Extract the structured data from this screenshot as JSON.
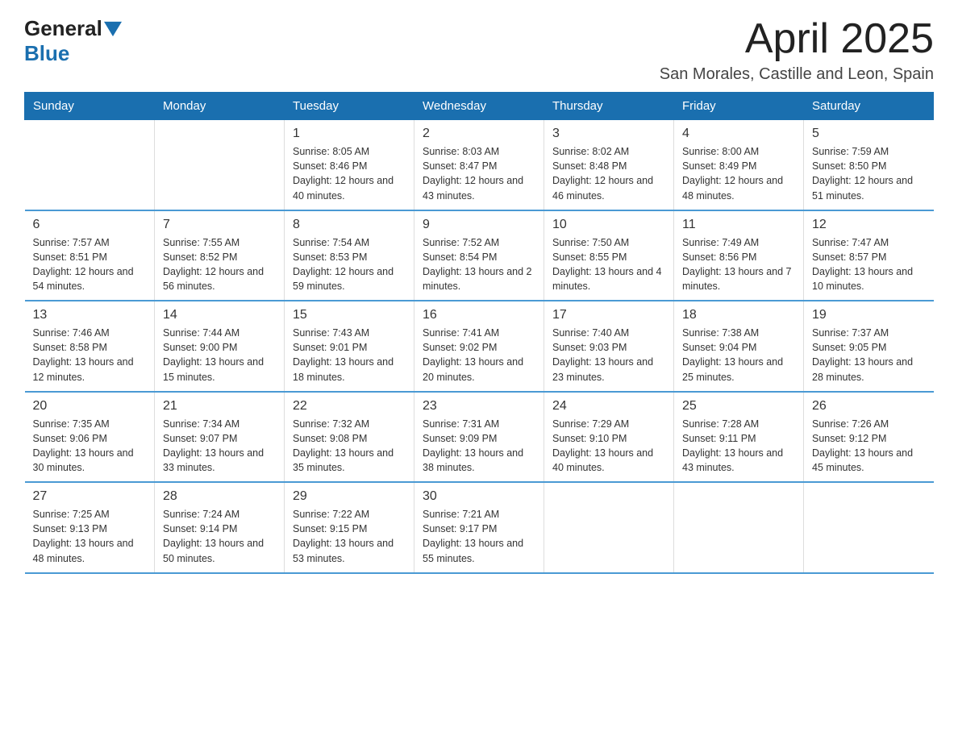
{
  "logo": {
    "text_general": "General",
    "text_blue": "Blue"
  },
  "header": {
    "month": "April 2025",
    "location": "San Morales, Castille and Leon, Spain"
  },
  "weekdays": [
    "Sunday",
    "Monday",
    "Tuesday",
    "Wednesday",
    "Thursday",
    "Friday",
    "Saturday"
  ],
  "weeks": [
    [
      {
        "day": "",
        "sunrise": "",
        "sunset": "",
        "daylight": ""
      },
      {
        "day": "",
        "sunrise": "",
        "sunset": "",
        "daylight": ""
      },
      {
        "day": "1",
        "sunrise": "Sunrise: 8:05 AM",
        "sunset": "Sunset: 8:46 PM",
        "daylight": "Daylight: 12 hours and 40 minutes."
      },
      {
        "day": "2",
        "sunrise": "Sunrise: 8:03 AM",
        "sunset": "Sunset: 8:47 PM",
        "daylight": "Daylight: 12 hours and 43 minutes."
      },
      {
        "day": "3",
        "sunrise": "Sunrise: 8:02 AM",
        "sunset": "Sunset: 8:48 PM",
        "daylight": "Daylight: 12 hours and 46 minutes."
      },
      {
        "day": "4",
        "sunrise": "Sunrise: 8:00 AM",
        "sunset": "Sunset: 8:49 PM",
        "daylight": "Daylight: 12 hours and 48 minutes."
      },
      {
        "day": "5",
        "sunrise": "Sunrise: 7:59 AM",
        "sunset": "Sunset: 8:50 PM",
        "daylight": "Daylight: 12 hours and 51 minutes."
      }
    ],
    [
      {
        "day": "6",
        "sunrise": "Sunrise: 7:57 AM",
        "sunset": "Sunset: 8:51 PM",
        "daylight": "Daylight: 12 hours and 54 minutes."
      },
      {
        "day": "7",
        "sunrise": "Sunrise: 7:55 AM",
        "sunset": "Sunset: 8:52 PM",
        "daylight": "Daylight: 12 hours and 56 minutes."
      },
      {
        "day": "8",
        "sunrise": "Sunrise: 7:54 AM",
        "sunset": "Sunset: 8:53 PM",
        "daylight": "Daylight: 12 hours and 59 minutes."
      },
      {
        "day": "9",
        "sunrise": "Sunrise: 7:52 AM",
        "sunset": "Sunset: 8:54 PM",
        "daylight": "Daylight: 13 hours and 2 minutes."
      },
      {
        "day": "10",
        "sunrise": "Sunrise: 7:50 AM",
        "sunset": "Sunset: 8:55 PM",
        "daylight": "Daylight: 13 hours and 4 minutes."
      },
      {
        "day": "11",
        "sunrise": "Sunrise: 7:49 AM",
        "sunset": "Sunset: 8:56 PM",
        "daylight": "Daylight: 13 hours and 7 minutes."
      },
      {
        "day": "12",
        "sunrise": "Sunrise: 7:47 AM",
        "sunset": "Sunset: 8:57 PM",
        "daylight": "Daylight: 13 hours and 10 minutes."
      }
    ],
    [
      {
        "day": "13",
        "sunrise": "Sunrise: 7:46 AM",
        "sunset": "Sunset: 8:58 PM",
        "daylight": "Daylight: 13 hours and 12 minutes."
      },
      {
        "day": "14",
        "sunrise": "Sunrise: 7:44 AM",
        "sunset": "Sunset: 9:00 PM",
        "daylight": "Daylight: 13 hours and 15 minutes."
      },
      {
        "day": "15",
        "sunrise": "Sunrise: 7:43 AM",
        "sunset": "Sunset: 9:01 PM",
        "daylight": "Daylight: 13 hours and 18 minutes."
      },
      {
        "day": "16",
        "sunrise": "Sunrise: 7:41 AM",
        "sunset": "Sunset: 9:02 PM",
        "daylight": "Daylight: 13 hours and 20 minutes."
      },
      {
        "day": "17",
        "sunrise": "Sunrise: 7:40 AM",
        "sunset": "Sunset: 9:03 PM",
        "daylight": "Daylight: 13 hours and 23 minutes."
      },
      {
        "day": "18",
        "sunrise": "Sunrise: 7:38 AM",
        "sunset": "Sunset: 9:04 PM",
        "daylight": "Daylight: 13 hours and 25 minutes."
      },
      {
        "day": "19",
        "sunrise": "Sunrise: 7:37 AM",
        "sunset": "Sunset: 9:05 PM",
        "daylight": "Daylight: 13 hours and 28 minutes."
      }
    ],
    [
      {
        "day": "20",
        "sunrise": "Sunrise: 7:35 AM",
        "sunset": "Sunset: 9:06 PM",
        "daylight": "Daylight: 13 hours and 30 minutes."
      },
      {
        "day": "21",
        "sunrise": "Sunrise: 7:34 AM",
        "sunset": "Sunset: 9:07 PM",
        "daylight": "Daylight: 13 hours and 33 minutes."
      },
      {
        "day": "22",
        "sunrise": "Sunrise: 7:32 AM",
        "sunset": "Sunset: 9:08 PM",
        "daylight": "Daylight: 13 hours and 35 minutes."
      },
      {
        "day": "23",
        "sunrise": "Sunrise: 7:31 AM",
        "sunset": "Sunset: 9:09 PM",
        "daylight": "Daylight: 13 hours and 38 minutes."
      },
      {
        "day": "24",
        "sunrise": "Sunrise: 7:29 AM",
        "sunset": "Sunset: 9:10 PM",
        "daylight": "Daylight: 13 hours and 40 minutes."
      },
      {
        "day": "25",
        "sunrise": "Sunrise: 7:28 AM",
        "sunset": "Sunset: 9:11 PM",
        "daylight": "Daylight: 13 hours and 43 minutes."
      },
      {
        "day": "26",
        "sunrise": "Sunrise: 7:26 AM",
        "sunset": "Sunset: 9:12 PM",
        "daylight": "Daylight: 13 hours and 45 minutes."
      }
    ],
    [
      {
        "day": "27",
        "sunrise": "Sunrise: 7:25 AM",
        "sunset": "Sunset: 9:13 PM",
        "daylight": "Daylight: 13 hours and 48 minutes."
      },
      {
        "day": "28",
        "sunrise": "Sunrise: 7:24 AM",
        "sunset": "Sunset: 9:14 PM",
        "daylight": "Daylight: 13 hours and 50 minutes."
      },
      {
        "day": "29",
        "sunrise": "Sunrise: 7:22 AM",
        "sunset": "Sunset: 9:15 PM",
        "daylight": "Daylight: 13 hours and 53 minutes."
      },
      {
        "day": "30",
        "sunrise": "Sunrise: 7:21 AM",
        "sunset": "Sunset: 9:17 PM",
        "daylight": "Daylight: 13 hours and 55 minutes."
      },
      {
        "day": "",
        "sunrise": "",
        "sunset": "",
        "daylight": ""
      },
      {
        "day": "",
        "sunrise": "",
        "sunset": "",
        "daylight": ""
      },
      {
        "day": "",
        "sunrise": "",
        "sunset": "",
        "daylight": ""
      }
    ]
  ]
}
